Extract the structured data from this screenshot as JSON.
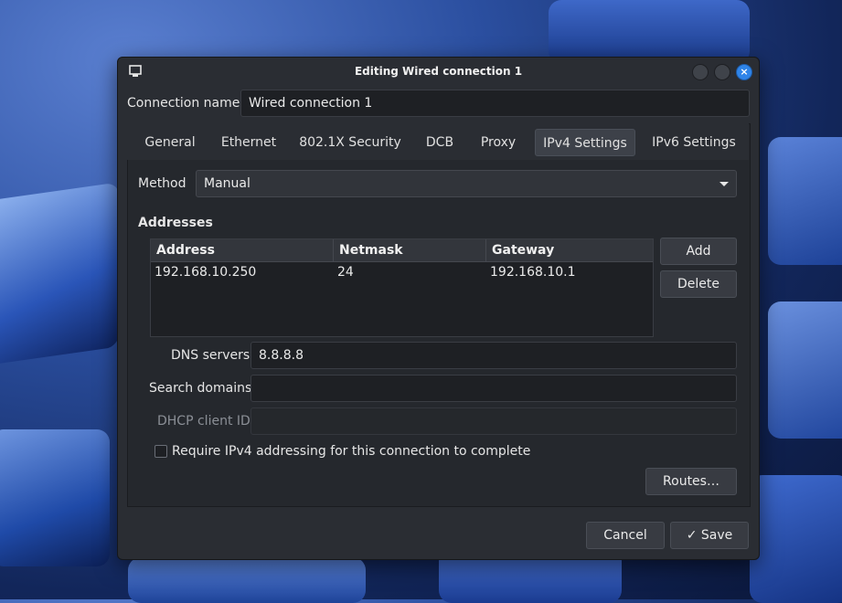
{
  "window": {
    "title": "Editing Wired connection 1",
    "close_icon": "×"
  },
  "connection": {
    "name_label": "Connection name",
    "name_value": "Wired connection 1"
  },
  "tabs": [
    {
      "label": "General",
      "active": false
    },
    {
      "label": "Ethernet",
      "active": false
    },
    {
      "label": "802.1X Security",
      "active": false
    },
    {
      "label": "DCB",
      "active": false
    },
    {
      "label": "Proxy",
      "active": false
    },
    {
      "label": "IPv4 Settings",
      "active": true
    },
    {
      "label": "IPv6 Settings",
      "active": false
    }
  ],
  "ipv4": {
    "method_label": "Method",
    "method_value": "Manual",
    "addresses_heading": "Addresses",
    "columns": [
      "Address",
      "Netmask",
      "Gateway"
    ],
    "rows": [
      [
        "192.168.10.250",
        "24",
        "192.168.10.1"
      ]
    ],
    "add_label": "Add",
    "delete_label": "Delete",
    "dns_label": "DNS servers",
    "dns_value": "8.8.8.8",
    "search_label": "Search domains",
    "search_value": "",
    "dhcp_label": "DHCP client ID",
    "dhcp_value": "",
    "require_label": "Require IPv4 addressing for this connection to complete",
    "require_checked": false,
    "routes_label": "Routes…"
  },
  "footer": {
    "cancel_label": "Cancel",
    "save_label": "Save",
    "save_icon": "✓"
  },
  "colors": {
    "accent": "#2f84e8",
    "window_bg": "#2a2d33"
  }
}
